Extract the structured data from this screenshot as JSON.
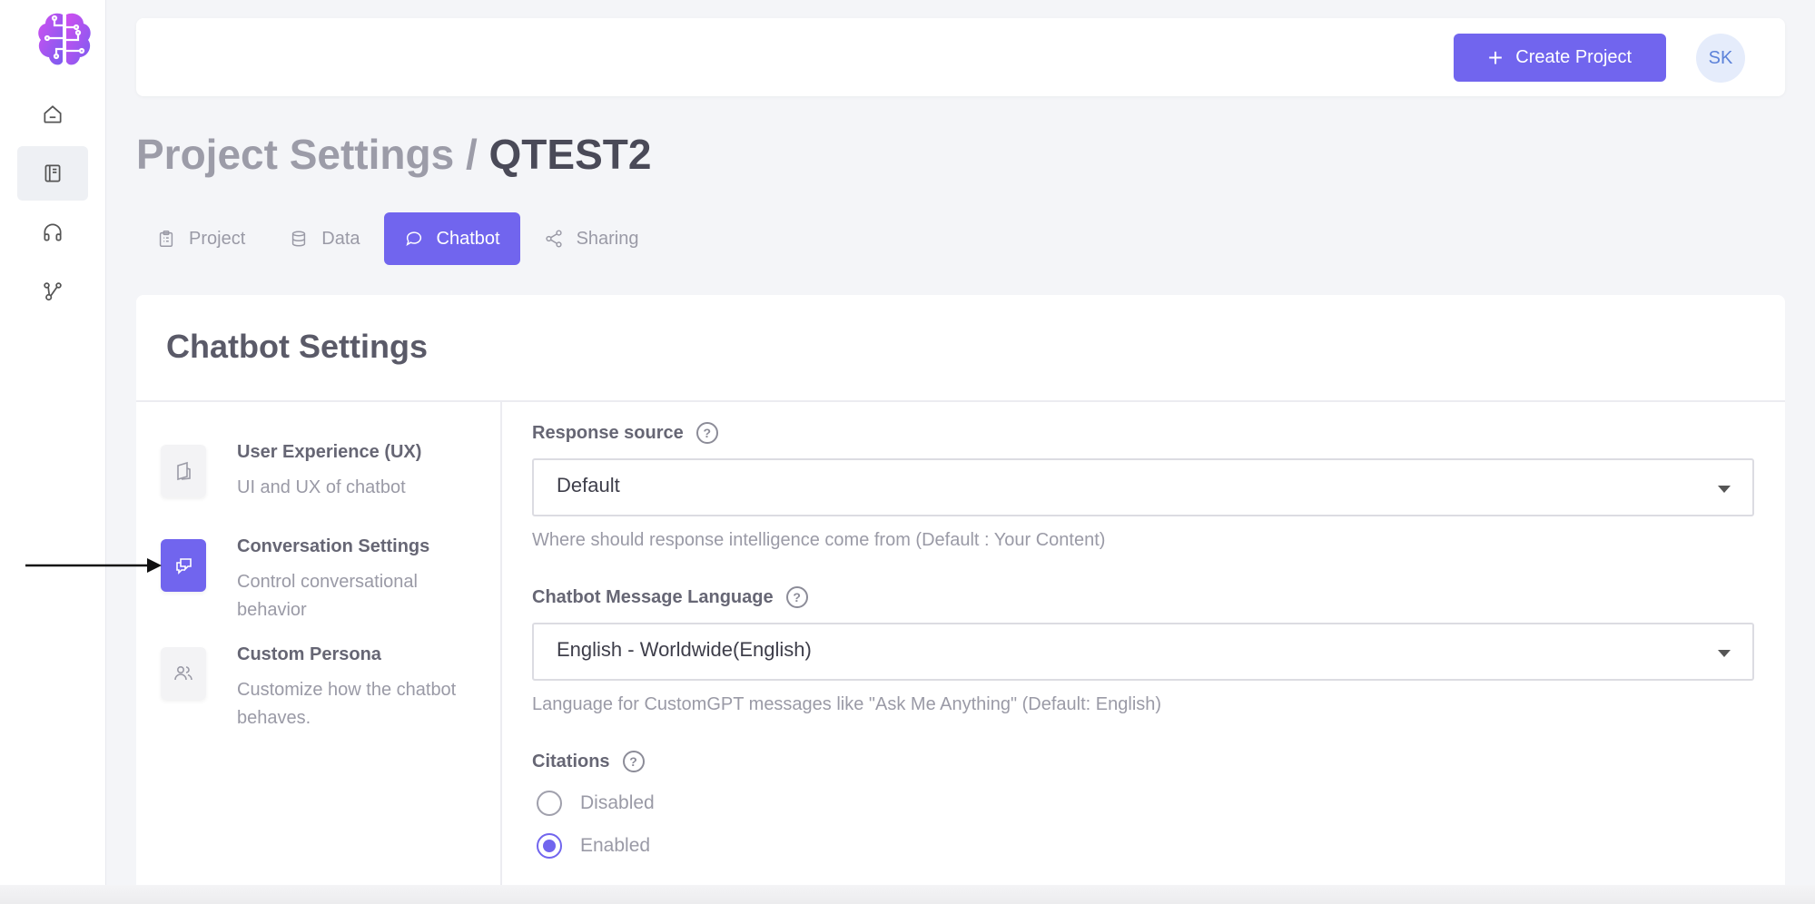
{
  "sidebar": {
    "items": [
      {
        "icon": "home-icon"
      },
      {
        "icon": "book-icon",
        "active": true
      },
      {
        "icon": "headset-icon"
      },
      {
        "icon": "integrations-icon"
      }
    ]
  },
  "header": {
    "create_label": "Create Project",
    "avatar_initials": "SK"
  },
  "page": {
    "title_prefix": "Project Settings / ",
    "project_name": "QTEST2"
  },
  "tabs": [
    {
      "label": "Project",
      "icon": "clipboard-icon"
    },
    {
      "label": "Data",
      "icon": "database-icon"
    },
    {
      "label": "Chatbot",
      "icon": "chat-bubble-icon",
      "active": true
    },
    {
      "label": "Sharing",
      "icon": "share-icon"
    }
  ],
  "settings": {
    "title": "Chatbot Settings",
    "sections": [
      {
        "name": "User Experience (UX)",
        "desc": "UI and UX of chatbot",
        "icon": "layout-icon"
      },
      {
        "name": "Conversation Settings",
        "desc": "Control conversational behavior",
        "icon": "conversation-icon",
        "active": true
      },
      {
        "name": "Custom Persona",
        "desc": "Customize how the chatbot behaves.",
        "icon": "users-icon"
      }
    ],
    "form": {
      "response_source": {
        "label": "Response source",
        "value": "Default",
        "helper": "Where should response intelligence come from (Default : Your Content)"
      },
      "language": {
        "label": "Chatbot Message Language",
        "value": "English - Worldwide(English)",
        "helper": "Language for CustomGPT messages like \"Ask Me Anything\" (Default: English)"
      },
      "citations": {
        "label": "Citations",
        "options": [
          "Disabled",
          "Enabled"
        ],
        "selected": "Enabled"
      },
      "help_glyph": "?"
    }
  },
  "colors": {
    "accent": "#7165ee",
    "text_muted": "#9a9aa6"
  }
}
